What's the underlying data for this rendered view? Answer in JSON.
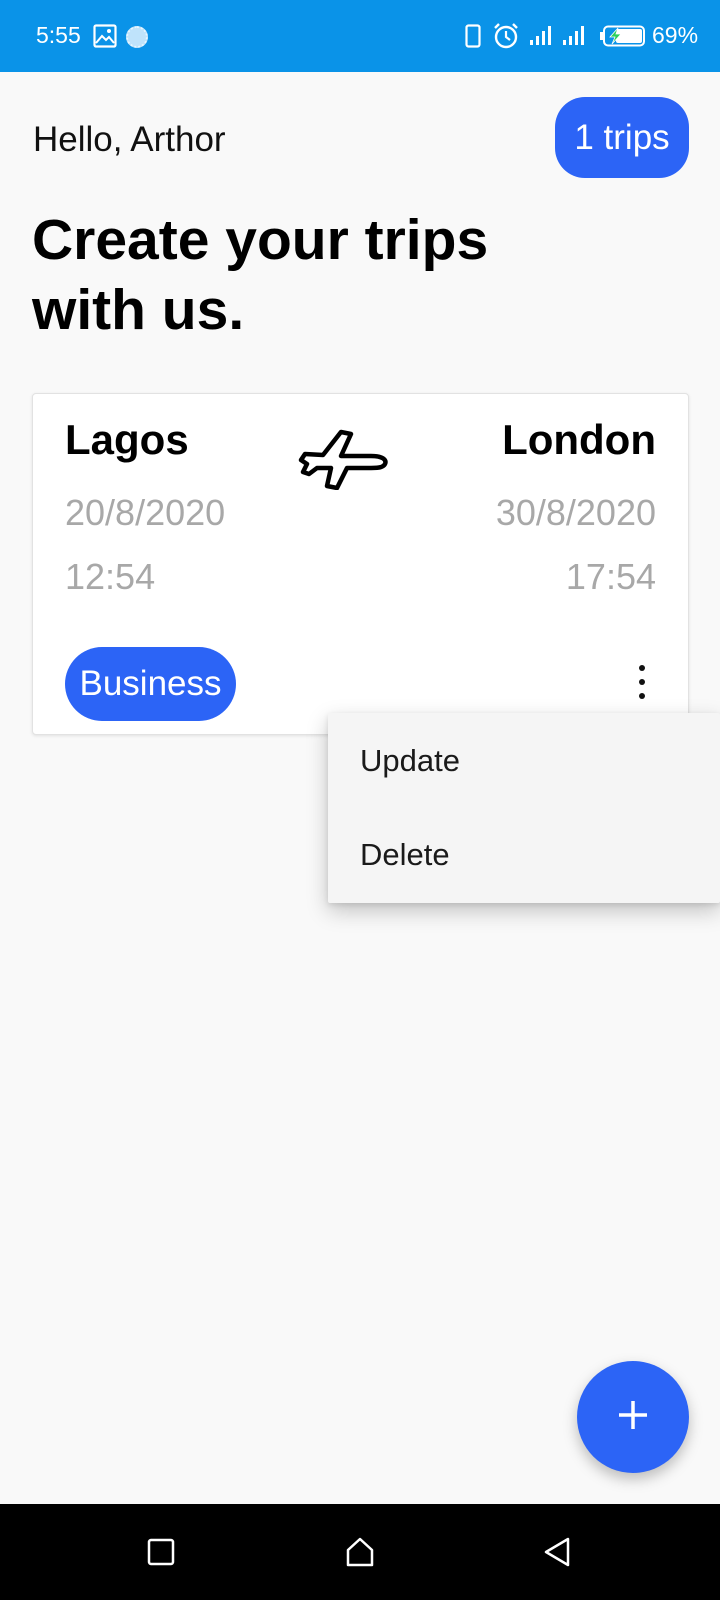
{
  "status_bar": {
    "time": "5:55",
    "battery_percent": "69%",
    "icons": [
      "image-icon",
      "sync-icon",
      "phone-icon",
      "alarm-icon",
      "signal-icon",
      "signal-icon",
      "battery-charging-icon"
    ]
  },
  "header": {
    "greeting": "Hello, Arthor",
    "trips_count_label": "1 trips",
    "headline": "Create your trips with us."
  },
  "trip": {
    "origin_city": "Lagos",
    "destination_city": "London",
    "departure_date": "20/8/2020",
    "arrival_date": "30/8/2020",
    "departure_time": "12:54",
    "arrival_time": "17:54",
    "travel_class": "Business",
    "icons": [
      "airplane-icon",
      "more-vert-icon"
    ]
  },
  "popup_menu": {
    "items": [
      {
        "label": "Update"
      },
      {
        "label": "Delete"
      }
    ]
  },
  "fab": {
    "icon": "plus-icon"
  },
  "nav_bar": {
    "icons": [
      "recents-icon",
      "home-icon",
      "back-icon"
    ]
  },
  "colors": {
    "status_bar": "#0a93e8",
    "accent": "#2c64f6",
    "background": "#f9f9f9",
    "muted_text": "#a8a8a8"
  }
}
